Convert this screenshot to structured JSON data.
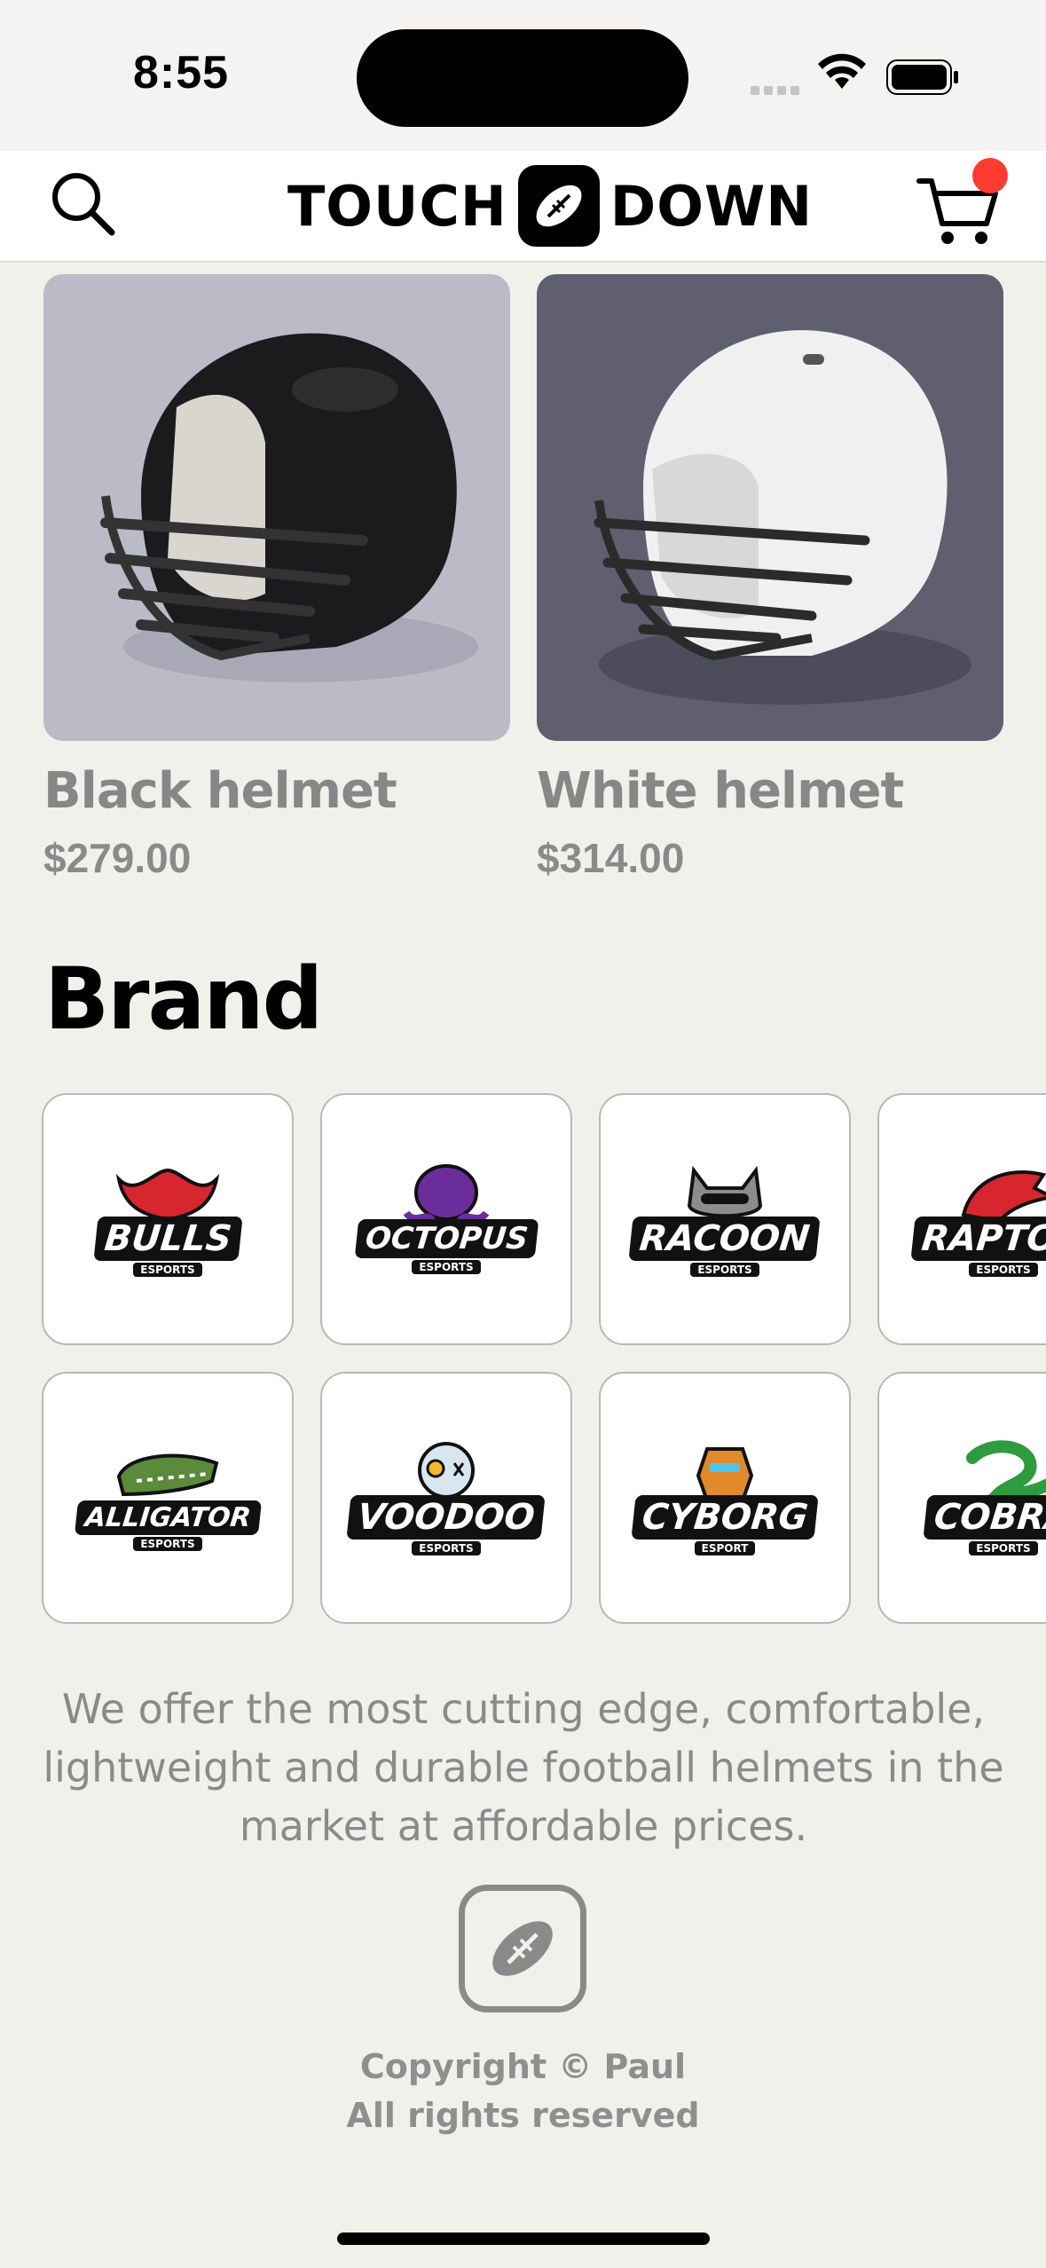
{
  "status_bar": {
    "time": "8:55"
  },
  "header": {
    "brand_left": "TOUCH",
    "brand_right": "DOWN",
    "icons": {
      "search": "search-icon",
      "cart": "cart-icon",
      "logo": "football-icon"
    },
    "cart_badge_color": "#ff3b30"
  },
  "products": [
    {
      "name": "Black helmet",
      "price": "$279.00",
      "bg": "#bbbbc8",
      "shell": "#1b1b1d"
    },
    {
      "name": "White helmet",
      "price": "$314.00",
      "bg": "#5f5f6f",
      "shell": "#f2f2f2"
    }
  ],
  "brand_section": {
    "title": "Brand",
    "brands": [
      {
        "name": "BULLS",
        "sub": "ESPORTS",
        "color": "#d7262e"
      },
      {
        "name": "OCTOPUS",
        "sub": "ESPORTS",
        "color": "#6b2d9a"
      },
      {
        "name": "RACOON",
        "sub": "ESPORTS",
        "color": "#8c8c8c"
      },
      {
        "name": "RAPTOR",
        "sub": "ESPORTS",
        "color": "#d7262e"
      },
      {
        "name": "ALLIGATOR",
        "sub": "ESPORTS",
        "color": "#5a8a3a"
      },
      {
        "name": "VOODOO",
        "sub": "ESPORTS",
        "color": "#d7e6ef"
      },
      {
        "name": "CYBORG",
        "sub": "ESPORT",
        "color": "#e08a2a"
      },
      {
        "name": "COBRA",
        "sub": "ESPORTS",
        "color": "#2e9b3e"
      }
    ]
  },
  "footer": {
    "about": "We offer the most cutting edge, comfortable, lightweight and durable football helmets in the market at affordable prices.",
    "copyright_line1": "Copyright © Paul",
    "copyright_line2": "All rights reserved"
  }
}
